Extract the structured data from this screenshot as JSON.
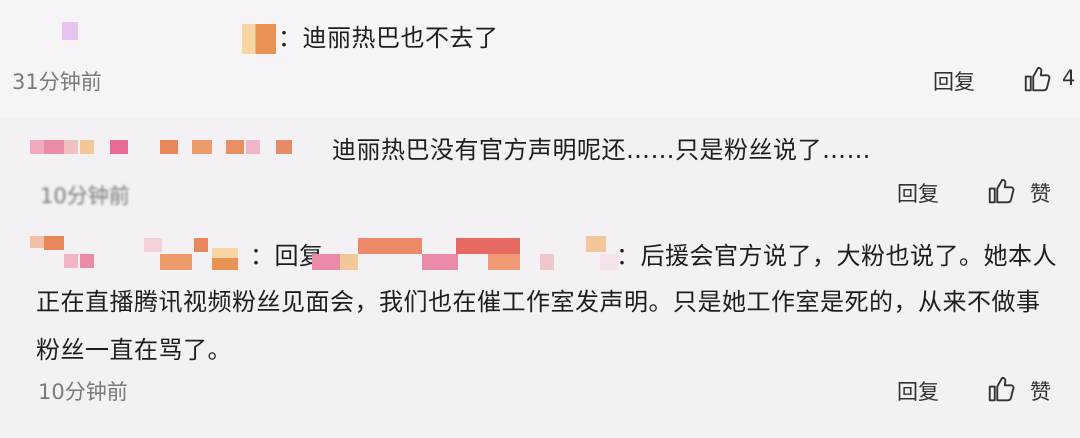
{
  "comments": [
    {
      "reply_text": "：迪丽热巴也不去了",
      "time": "31分钟前",
      "reply_label": "回复",
      "like_count": "4"
    },
    {
      "text": "迪丽热巴没有官方声明呢还……只是粉丝说了……",
      "time": "10分钟前",
      "reply_label": "回复",
      "like_label": "赞"
    },
    {
      "reply_prefix": "：回复",
      "line1_tail": "：后援会官方说了，大粉也说了。她本人",
      "line2": "正在直播腾讯视频粉丝见面会，我们也在催工作室发声明。只是她工作室是死的，从来不做事",
      "line3": "粉丝一直在骂了。",
      "time": "10分钟前",
      "reply_label": "回复",
      "like_label": "赞"
    }
  ],
  "icons": {
    "like": "thumbs-up-icon"
  },
  "colors": {
    "pixel_pink": "#e98aa6",
    "pixel_orange": "#e8875a",
    "pixel_lilac": "#e6c3ec",
    "time_gray": "#7a7a7a"
  }
}
